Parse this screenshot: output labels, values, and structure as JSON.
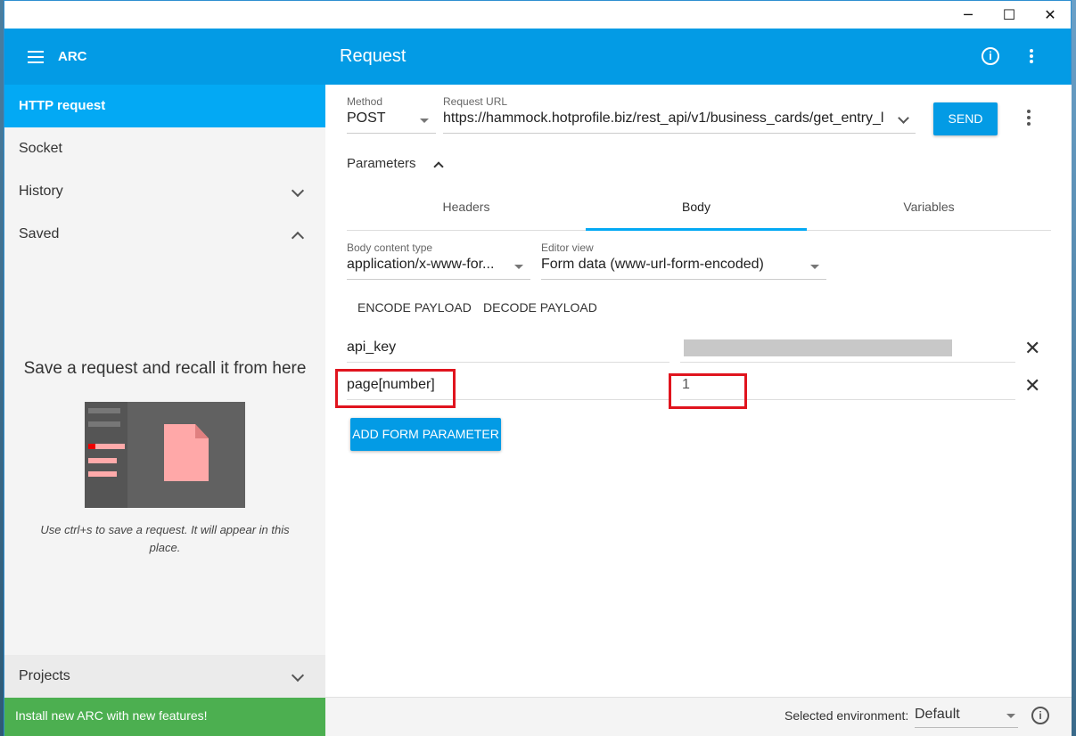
{
  "window": {
    "minimize_glyph": "─",
    "maximize_glyph": "☐",
    "close_glyph": "✕"
  },
  "appbar": {
    "app_name": "ARC",
    "title": "Request"
  },
  "sidebar": {
    "items": [
      {
        "label": "HTTP request"
      },
      {
        "label": "Socket"
      },
      {
        "label": "History"
      },
      {
        "label": "Saved"
      }
    ],
    "saved_empty": {
      "title": "Save a request and recall it from here",
      "description": "Use ctrl+s to save a request. It will appear in this place."
    },
    "projects_label": "Projects",
    "upgrade_banner": "Install new ARC with new features!"
  },
  "request": {
    "method_label": "Method",
    "method_value": "POST",
    "url_label": "Request URL",
    "url_value": "https://hammock.hotprofile.biz/rest_api/v1/business_cards/get_entry_l",
    "send_label": "SEND",
    "parameters_label": "Parameters",
    "tabs": [
      {
        "label": "Headers"
      },
      {
        "label": "Body"
      },
      {
        "label": "Variables"
      }
    ],
    "body_content_type_label": "Body content type",
    "body_content_type_value": "application/x-www-for...",
    "editor_view_label": "Editor view",
    "editor_view_value": "Form data (www-url-form-encoded)",
    "encode_label": "ENCODE PAYLOAD",
    "decode_label": "DECODE PAYLOAD",
    "params": [
      {
        "name": "api_key",
        "value": ""
      },
      {
        "name": "page[number]",
        "value": "1"
      }
    ],
    "add_param_label": "ADD FORM PARAMETER"
  },
  "footer": {
    "env_label": "Selected environment:",
    "env_value": "Default"
  },
  "colors": {
    "primary": "#039be5",
    "active_nav": "#03a9f4",
    "banner": "#4caf50",
    "highlight": "#e0141e"
  }
}
